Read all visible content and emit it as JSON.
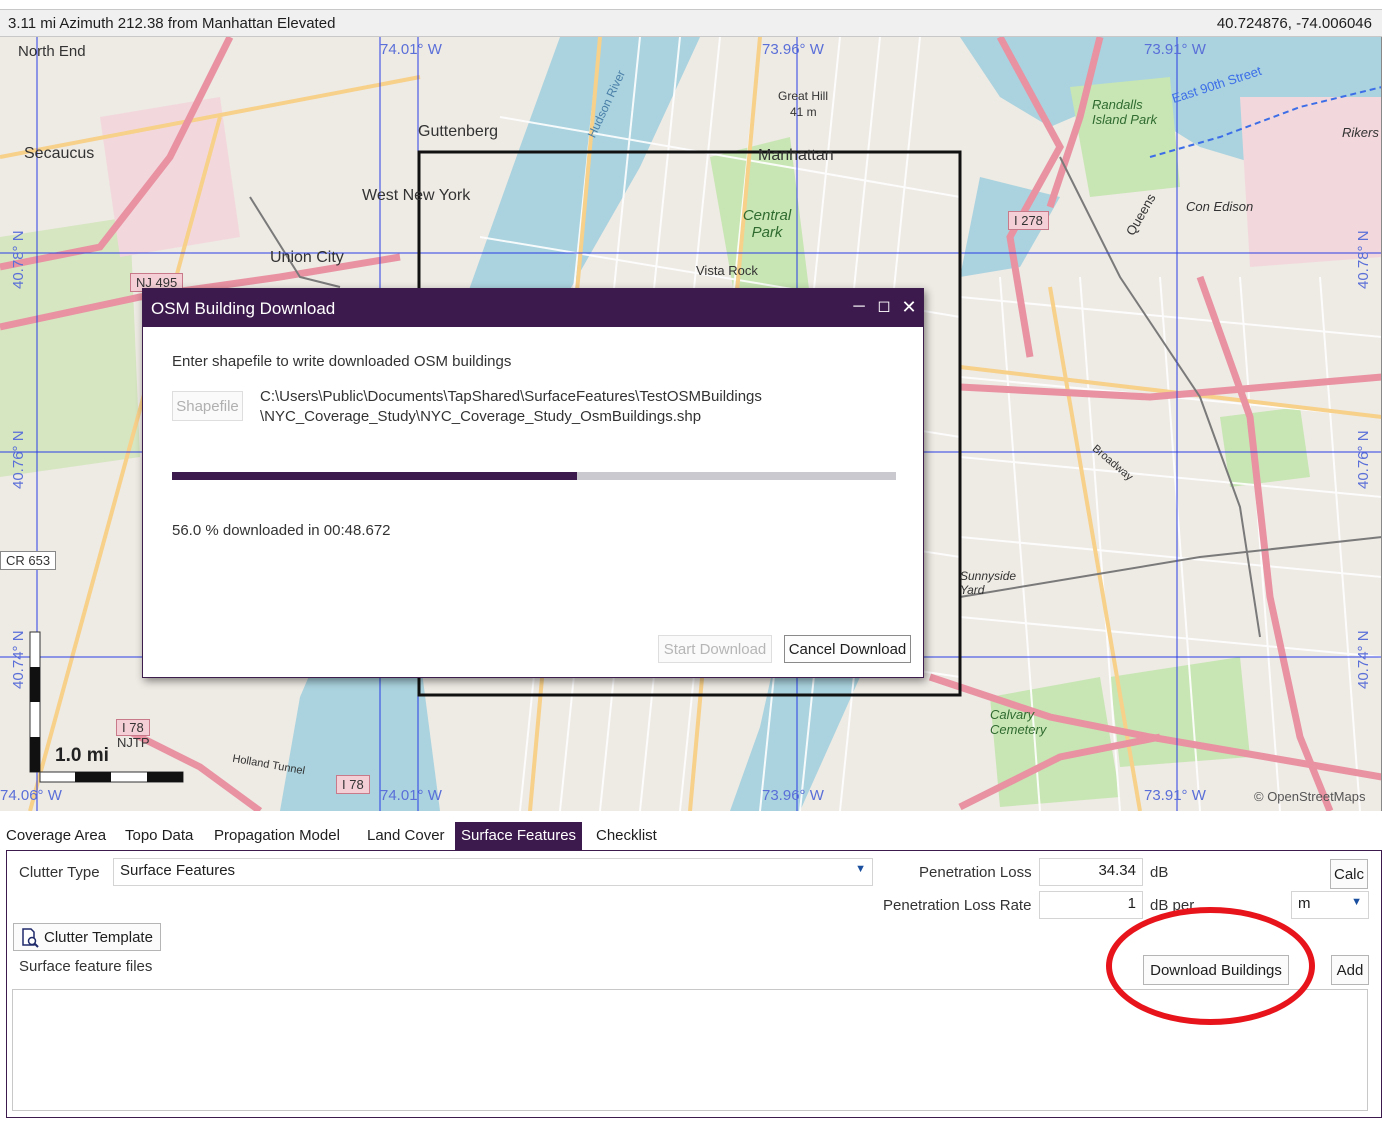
{
  "status": {
    "left": "3.11 mi Azimuth 212.38 from Manhattan Elevated",
    "right": "40.724876, -74.006046"
  },
  "map": {
    "places": {
      "north_end": "North End",
      "secaucus": "Secaucus",
      "guttenberg": "Guttenberg",
      "west_new_york": "West New York",
      "union_city": "Union City",
      "manhattan": "Manhattan",
      "central_park": "Central Park",
      "vista_rock": "Vista Rock",
      "great_hill": "Great Hill",
      "great_hill_elev": "41 m",
      "randalls_island_park": "Randalls Island Park",
      "con_edison": "Con Edison",
      "rikers": "Rikers",
      "sunnyside_yard": "Sunnyside Yard",
      "calvary_cemetery": "Calvary Cemetery",
      "east_90th_street": "East 90th Street",
      "holland_tunnel": "Holland Tunnel",
      "njtp": "NJTP",
      "queens": "Queens",
      "broadway": "Broadway",
      "hudson_river": "Hudson River"
    },
    "shields": {
      "i278": "I 278",
      "nj495": "NJ 495",
      "cr653": "CR 653",
      "i78_a": "I 78",
      "i78_b": "I 78"
    },
    "grid": {
      "lon1": "74.01° W",
      "lon2": "73.96° W",
      "lon3": "73.91° W",
      "lon4": "74.06° W",
      "lat1": "40.78° N",
      "lat2": "40.76° N",
      "lat3": "40.74° N"
    },
    "scale_label": "1.0 mi",
    "attribution": "© OpenStreetMaps"
  },
  "dialog": {
    "title": "OSM Building Download",
    "prompt": "Enter shapefile to write downloaded OSM buildings",
    "shapefile_button": "Shapefile",
    "path_line1": "C:\\Users\\Public\\Documents\\TapShared\\SurfaceFeatures\\TestOSMBuildings",
    "path_line2": "\\NYC_Coverage_Study\\NYC_Coverage_Study_OsmBuildings.shp",
    "progress_fraction": 0.56,
    "progress_text": "56.0 % downloaded in 00:48.672",
    "start_button": "Start Download",
    "cancel_button": "Cancel Download"
  },
  "tabs": [
    "Coverage Area",
    "Topo Data",
    "Propagation Model",
    "Land Cover",
    "Surface Features",
    "Checklist"
  ],
  "active_tab": "Surface Features",
  "panel": {
    "clutter_type_label": "Clutter Type",
    "clutter_type_value": "Surface Features",
    "penetration_loss_label": "Penetration Loss",
    "penetration_loss_value": "34.34",
    "penetration_loss_unit": "dB",
    "calc_button": "Calc",
    "penetration_rate_label": "Penetration Loss Rate",
    "penetration_rate_value": "1",
    "penetration_rate_unit": "dB per",
    "rate_unit_select": "m",
    "clutter_template_button": "Clutter Template",
    "surface_files_label": "Surface feature files",
    "download_buildings_button": "Download Buildings",
    "add_button": "Add"
  },
  "colors": {
    "accent": "#3d1a4d",
    "highlight": "#e8141b",
    "water": "#aad3df",
    "park": "#c8e6b4",
    "road_major": "#e892a2",
    "road_secondary": "#f7d08a"
  }
}
